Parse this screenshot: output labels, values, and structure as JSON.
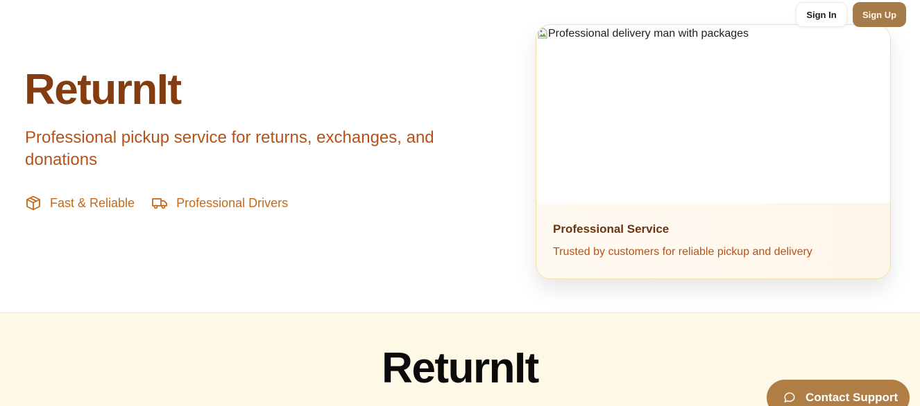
{
  "header": {
    "signin_label": "Sign In",
    "signup_label": "Sign Up"
  },
  "hero": {
    "brand": "ReturnIt",
    "tagline": "Professional pickup service for returns, exchanges, and donations",
    "features": [
      {
        "icon": "package-icon",
        "label": "Fast & Reliable"
      },
      {
        "icon": "truck-icon",
        "label": "Professional Drivers"
      }
    ]
  },
  "card": {
    "image_alt": "Professional delivery man with packages",
    "title": "Professional Service",
    "text": "Trusted by customers for reliable pickup and delivery"
  },
  "section2": {
    "title": "ReturnIt"
  },
  "support": {
    "icon": "chat-bubble-icon",
    "label": "Contact Support"
  },
  "colors": {
    "brand": "#843d10",
    "accent": "#b3531a",
    "button": "#a57b4a",
    "section_bg": "#fef9e7"
  }
}
